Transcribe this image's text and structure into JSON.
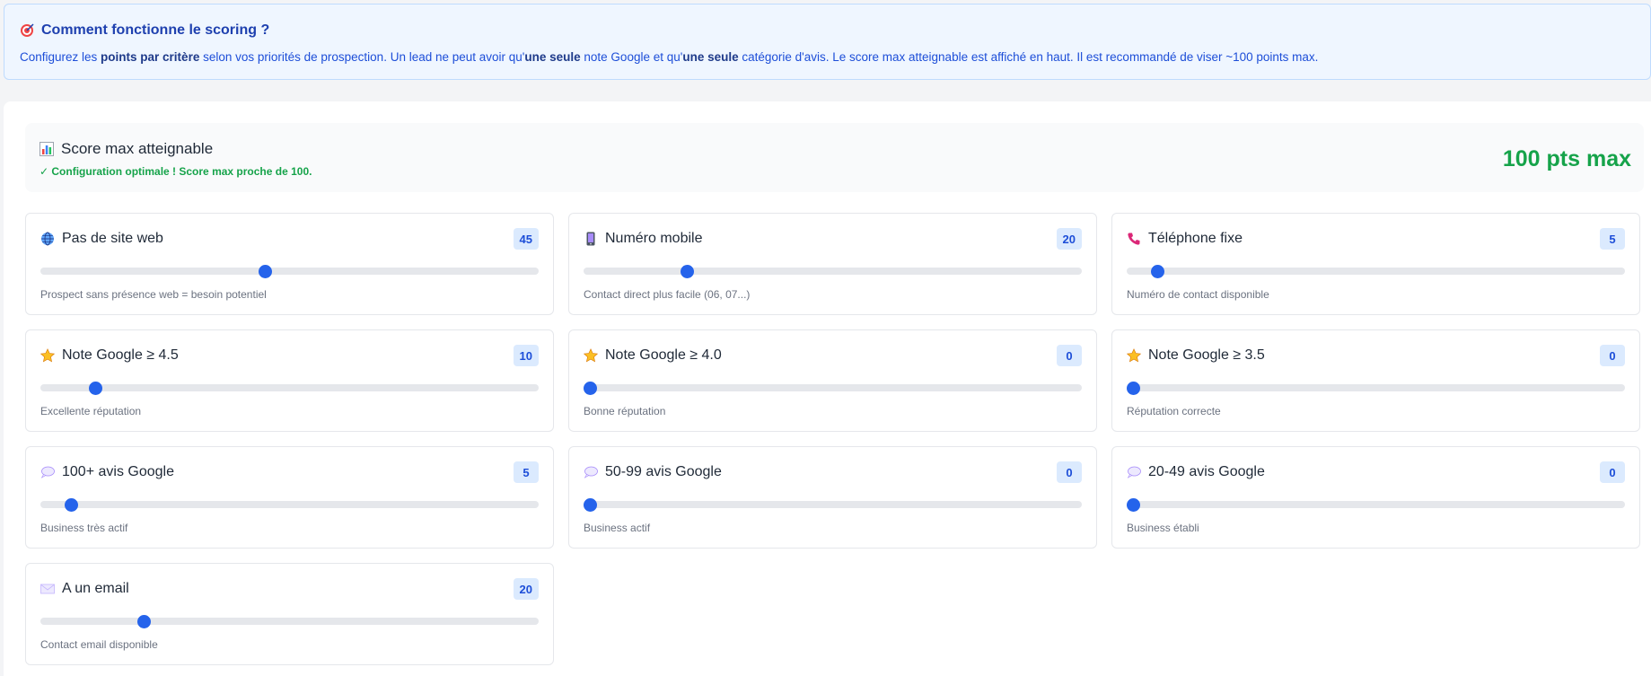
{
  "info": {
    "title": "Comment fonctionne le scoring ?",
    "text_1": "Configurez les ",
    "bold_1": "points par critère",
    "text_2": " selon vos priorités de prospection. Un lead ne peut avoir qu'",
    "bold_2": "une seule",
    "text_3": " note Google et qu'",
    "bold_3": "une seule",
    "text_4": " catégorie d'avis. Le score max atteignable est affiché en haut. Il est recommandé de viser ~100 points max.",
    "icon": "target-icon"
  },
  "max_score": {
    "title": "Score max atteignable",
    "subtitle": "✓ Configuration optimale ! Score max proche de 100.",
    "value_label": "100 pts max",
    "icon": "bar-chart-icon"
  },
  "slider_max": 100,
  "criteria": [
    {
      "label": "Pas de site web",
      "points": 45,
      "desc": "Prospect sans présence web = besoin potentiel",
      "icon": "globe-icon"
    },
    {
      "label": "Numéro mobile",
      "points": 20,
      "desc": "Contact direct plus facile (06, 07...)",
      "icon": "mobile-phone-icon"
    },
    {
      "label": "Téléphone fixe",
      "points": 5,
      "desc": "Numéro de contact disponible",
      "icon": "telephone-icon"
    },
    {
      "label": "Note Google ≥ 4.5",
      "points": 10,
      "desc": "Excellente réputation",
      "icon": "star-icon"
    },
    {
      "label": "Note Google ≥ 4.0",
      "points": 0,
      "desc": "Bonne réputation",
      "icon": "star-icon"
    },
    {
      "label": "Note Google ≥ 3.5",
      "points": 0,
      "desc": "Réputation correcte",
      "icon": "star-icon"
    },
    {
      "label": "100+ avis Google",
      "points": 5,
      "desc": "Business très actif",
      "icon": "speech-bubble-icon"
    },
    {
      "label": "50-99 avis Google",
      "points": 0,
      "desc": "Business actif",
      "icon": "speech-bubble-icon"
    },
    {
      "label": "20-49 avis Google",
      "points": 0,
      "desc": "Business établi",
      "icon": "speech-bubble-icon"
    },
    {
      "label": "A un email",
      "points": 20,
      "desc": "Contact email disponible",
      "icon": "envelope-icon"
    }
  ],
  "colors": {
    "accent": "#2563eb",
    "success": "#16a34a",
    "info_bg": "#eff6ff"
  }
}
